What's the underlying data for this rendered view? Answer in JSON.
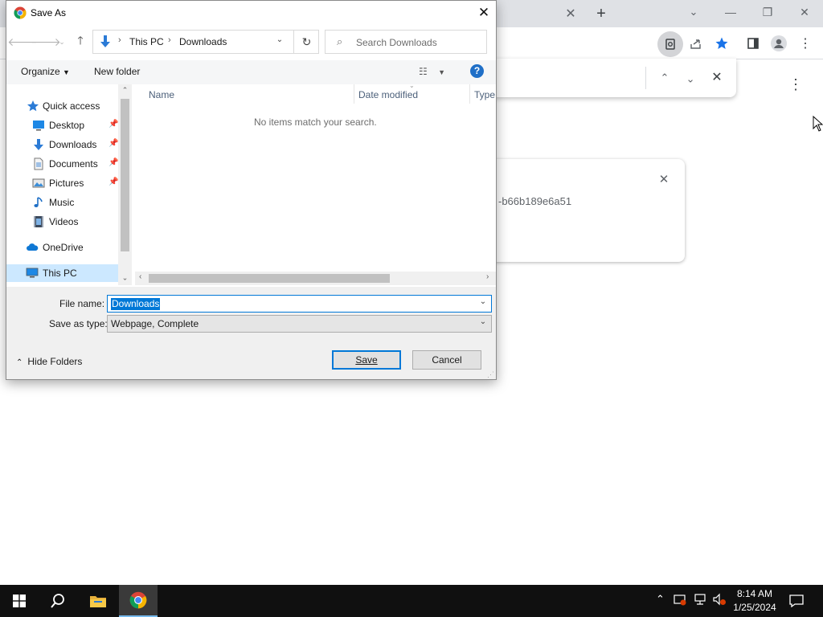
{
  "dialog": {
    "title": "Save As",
    "address": {
      "root": "This PC",
      "folder": "Downloads"
    },
    "search_placeholder": "Search Downloads",
    "commands": {
      "organize": "Organize",
      "new_folder": "New folder"
    },
    "nav": {
      "quick_access": "Quick access",
      "pinned": [
        {
          "label": "Desktop",
          "icon": "desktop-icon"
        },
        {
          "label": "Downloads",
          "icon": "downloads-icon"
        },
        {
          "label": "Documents",
          "icon": "documents-icon"
        },
        {
          "label": "Pictures",
          "icon": "pictures-icon"
        },
        {
          "label": "Music",
          "icon": "music-icon"
        },
        {
          "label": "Videos",
          "icon": "videos-icon"
        }
      ],
      "onedrive": "OneDrive",
      "this_pc": "This PC"
    },
    "columns": {
      "name": "Name",
      "date_modified": "Date modified",
      "type": "Type"
    },
    "empty_message": "No items match your search.",
    "file_name_label": "File name:",
    "file_name_value": "Downloads",
    "save_type_label": "Save as type:",
    "save_type_value": "Webpage, Complete",
    "hide_folders": "Hide Folders",
    "save_button": "Save",
    "cancel_button": "Cancel"
  },
  "browser": {
    "download_card_text": "-b66b189e6a51"
  },
  "taskbar": {
    "time": "8:14 AM",
    "date": "1/25/2024"
  },
  "colors": {
    "accent": "#0078d7",
    "selection_bg": "#cce8ff",
    "chrome_frame": "#dfe1e5",
    "bookmark_star": "#1a73e8"
  }
}
